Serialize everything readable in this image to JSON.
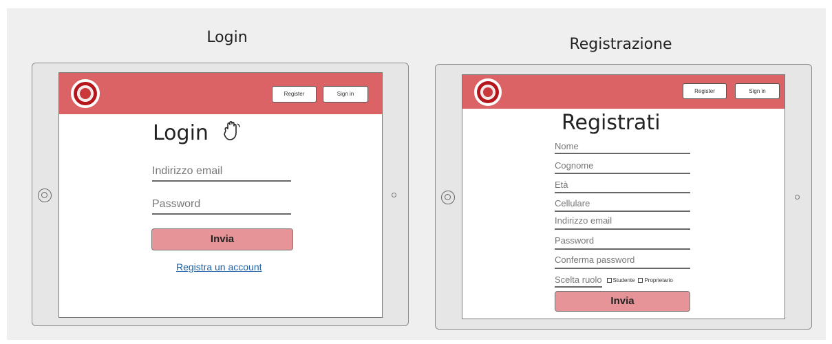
{
  "login_section": {
    "title": "Login",
    "header": {
      "register_label": "Register",
      "signin_label": "Sign in"
    },
    "heading": "Login",
    "email_placeholder": "Indirizzo email",
    "password_placeholder": "Password",
    "submit_label": "Invia",
    "register_link": "Registra un account"
  },
  "register_section": {
    "title": "Registrazione",
    "header": {
      "register_label": "Register",
      "signin_label": "Sign in"
    },
    "heading": "Registrati",
    "fields": [
      "Nome",
      "Cognome",
      "Età",
      "Cellulare",
      "Indirizzo email",
      "Password",
      "Conferma password"
    ],
    "role_label": "Scelta ruolo",
    "role_options": [
      "Studente",
      "Proprietario"
    ],
    "submit_label": "Invia"
  },
  "icons": {
    "wave": "hand-wave-icon",
    "logo": "university-seal-logo"
  },
  "colors": {
    "header_bg": "#dc6365",
    "submit_bg": "#e69497",
    "link": "#1b5fa8"
  }
}
